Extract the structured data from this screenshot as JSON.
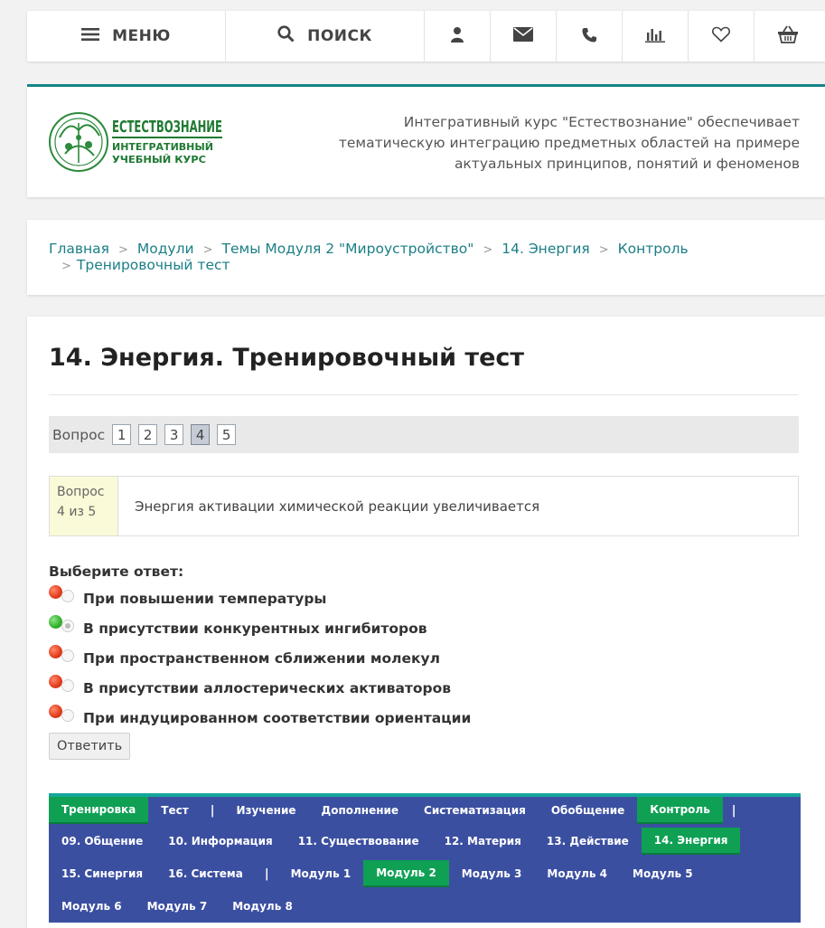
{
  "topbar": {
    "menu_label": "МЕНЮ",
    "search_label": "ПОИСК",
    "icons": [
      "user-icon",
      "mail-icon",
      "phone-icon",
      "chart-icon",
      "heart-icon",
      "basket-icon"
    ]
  },
  "header": {
    "logo": {
      "line1": "ЕСТЕСТВОЗНАНИЕ",
      "line2": "ИНТЕГРАТИВНЫЙ",
      "line3": "УЧЕБНЫЙ КУРС"
    },
    "tagline": "Интегративный курс \"Естествознание\" обеспечивает тематическую интеграцию предметных областей на примере актуальных принципов, понятий и феноменов"
  },
  "breadcrumb": {
    "items": [
      "Главная",
      "Модули",
      "Темы Модуля 2 \"Мироустройство\"",
      "14. Энергия",
      "Контроль",
      "Тренировочный тест"
    ]
  },
  "main": {
    "title": "14. Энергия. Тренировочный тест",
    "question_nav_label": "Вопрос",
    "question_numbers": [
      "1",
      "2",
      "3",
      "4",
      "5"
    ],
    "active_question": "4",
    "question_counter_line1": "Вопрос",
    "question_counter_line2": "4 из 5",
    "question_text": "Энергия активации химической реакции увеличивается",
    "choose_label": "Выберите ответ:",
    "answers": [
      {
        "label": "При повышении температуры",
        "marker": "red",
        "checked": false
      },
      {
        "label": "В присутствии конкурентных ингибиторов",
        "marker": "green",
        "checked": true
      },
      {
        "label": "При пространственном сближении молекул",
        "marker": "red",
        "checked": false
      },
      {
        "label": "В присутствии аллостерических активаторов",
        "marker": "red",
        "checked": false
      },
      {
        "label": "При индуцированном соответствии ориентации",
        "marker": "red",
        "checked": false
      }
    ],
    "submit_label": "Ответить"
  },
  "bottom_nav": {
    "row1": [
      "Тренировка",
      "Тест",
      "|",
      "Изучение",
      "Дополнение",
      "Систематизация",
      "Обобщение",
      "Контроль",
      "|"
    ],
    "row2": [
      "09. Общение",
      "10. Информация",
      "11. Существование",
      "12. Материя",
      "13. Действие",
      "14. Энергия"
    ],
    "row3": [
      "15. Синергия",
      "16. Система",
      "|",
      "Модуль 1",
      "Модуль 2",
      "Модуль 3",
      "Модуль 4",
      "Модуль 5"
    ],
    "row4": [
      "Модуль 6",
      "Модуль 7",
      "Модуль 8"
    ],
    "active": [
      "Тренировка",
      "Контроль",
      "14. Энергия",
      "Модуль 2"
    ]
  },
  "colors": {
    "teal": "#16868a",
    "nav_blue": "#3b4fa1",
    "nav_green": "#0fa054",
    "link": "#1b7f86"
  }
}
